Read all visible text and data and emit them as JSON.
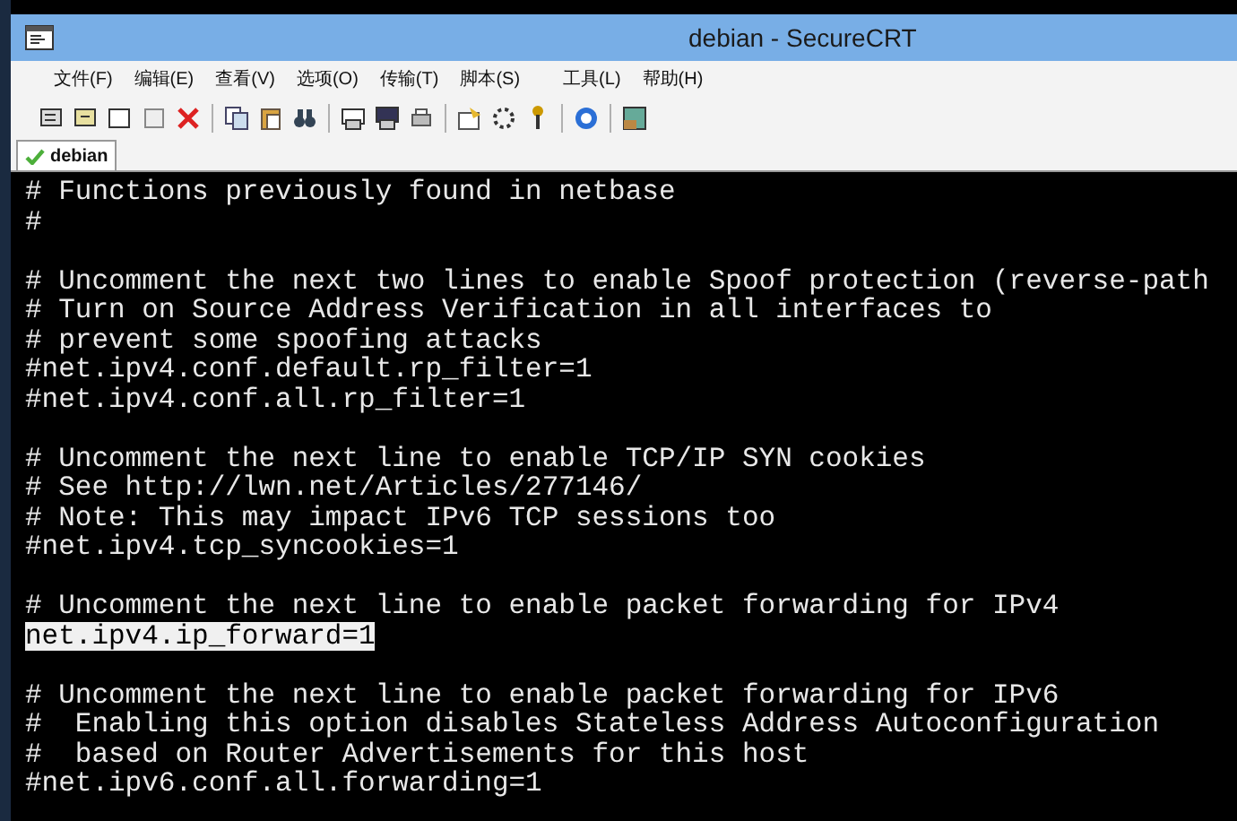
{
  "window": {
    "title": "debian - SecureCRT"
  },
  "menu": [
    "文件(F)",
    "编辑(E)",
    "查看(V)",
    "选项(O)",
    "传输(T)",
    "脚本(S)",
    "工具(L)",
    "帮助(H)"
  ],
  "tabs": [
    {
      "label": "debian",
      "selected": true
    }
  ],
  "terminal": {
    "lines": [
      {
        "kind": "text",
        "text": "# Functions previously found in netbase",
        "selected": false
      },
      {
        "kind": "text",
        "text": "#",
        "selected": false
      },
      {
        "kind": "blank"
      },
      {
        "kind": "text",
        "text": "# Uncomment the next two lines to enable Spoof protection (reverse-path",
        "selected": false
      },
      {
        "kind": "text",
        "text": "# Turn on Source Address Verification in all interfaces to",
        "selected": false
      },
      {
        "kind": "text",
        "text": "# prevent some spoofing attacks",
        "selected": false
      },
      {
        "kind": "text",
        "text": "#net.ipv4.conf.default.rp_filter=1",
        "selected": false
      },
      {
        "kind": "text",
        "text": "#net.ipv4.conf.all.rp_filter=1",
        "selected": false
      },
      {
        "kind": "blank"
      },
      {
        "kind": "text",
        "text": "# Uncomment the next line to enable TCP/IP SYN cookies",
        "selected": false
      },
      {
        "kind": "text",
        "text": "# See http://lwn.net/Articles/277146/",
        "selected": false
      },
      {
        "kind": "text",
        "text": "# Note: This may impact IPv6 TCP sessions too",
        "selected": false
      },
      {
        "kind": "text",
        "text": "#net.ipv4.tcp_syncookies=1",
        "selected": false
      },
      {
        "kind": "blank"
      },
      {
        "kind": "text",
        "text": "# Uncomment the next line to enable packet forwarding for IPv4",
        "selected": false
      },
      {
        "kind": "text",
        "text": "net.ipv4.ip_forward=1",
        "selected": true
      },
      {
        "kind": "blank"
      },
      {
        "kind": "text",
        "text": "# Uncomment the next line to enable packet forwarding for IPv6",
        "selected": false
      },
      {
        "kind": "text",
        "text": "#  Enabling this option disables Stateless Address Autoconfiguration",
        "selected": false
      },
      {
        "kind": "text",
        "text": "#  based on Router Advertisements for this host",
        "selected": false
      },
      {
        "kind": "text",
        "text": "#net.ipv6.conf.all.forwarding=1",
        "selected": false
      }
    ]
  }
}
